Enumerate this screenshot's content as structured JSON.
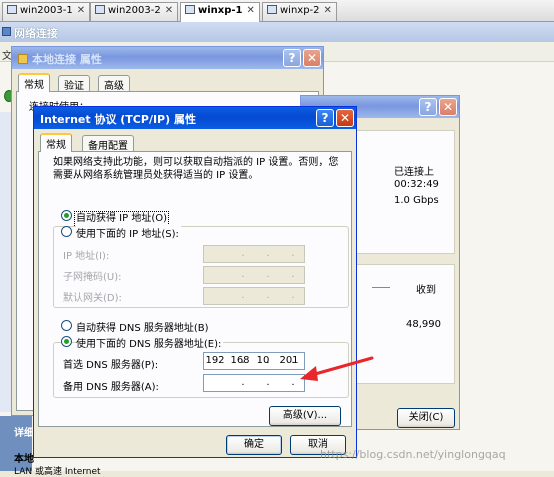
{
  "vm_tabs": [
    {
      "label": "win2003-1"
    },
    {
      "label": "win2003-2"
    },
    {
      "label": "winxp-1"
    },
    {
      "label": "winxp-2"
    }
  ],
  "background_window": {
    "title": "网络连接",
    "menu_fragment": "文",
    "detail_heading": "详细",
    "detail_item": "本地",
    "detail_sub": "LAN 或高速 Internet"
  },
  "local_props": {
    "title": "本地连接 属性",
    "tabs": [
      "常规",
      "验证",
      "高级"
    ],
    "connect_using": "连接时使用："
  },
  "status_window": {
    "status_label": "已连接上",
    "duration": "00:32:49",
    "speed": "1.0 Gbps",
    "received_label": "收到",
    "received_value": "48,990",
    "close_button": "关闭(C)"
  },
  "tcpip_dialog": {
    "title": "Internet 协议 (TCP/IP) 属性",
    "help_symbol": "?",
    "close_symbol": "✕",
    "tabs": [
      "常规",
      "备用配置"
    ],
    "intro": "如果网络支持此功能，则可以获取自动指派的 IP 设置。否则，您需要从网络系统管理员处获得适当的 IP 设置。",
    "auto_ip": "自动获得 IP 地址(O)",
    "manual_ip": "使用下面的 IP 地址(S):",
    "ip_label": "IP 地址(I):",
    "mask_label": "子网掩码(U):",
    "gateway_label": "默认网关(D):",
    "auto_dns": "自动获得 DNS 服务器地址(B)",
    "manual_dns": "使用下面的 DNS 服务器地址(E):",
    "preferred_dns_label": "首选 DNS 服务器(P):",
    "preferred_dns": [
      "192",
      "168",
      "10",
      "201"
    ],
    "alternate_dns_label": "备用 DNS 服务器(A):",
    "alternate_dns": [
      "",
      "",
      "",
      ""
    ],
    "advanced_button": "高级(V)...",
    "ok_button": "确定",
    "cancel_button": "取消"
  },
  "watermark": "https://blog.csdn.net/yinglongqaq",
  "colors": {
    "xp_title_blue": "#0a5fe3",
    "radio_green": "#21a121",
    "annotation_red": "#e8262b",
    "dialog_face": "#ece9d8"
  }
}
